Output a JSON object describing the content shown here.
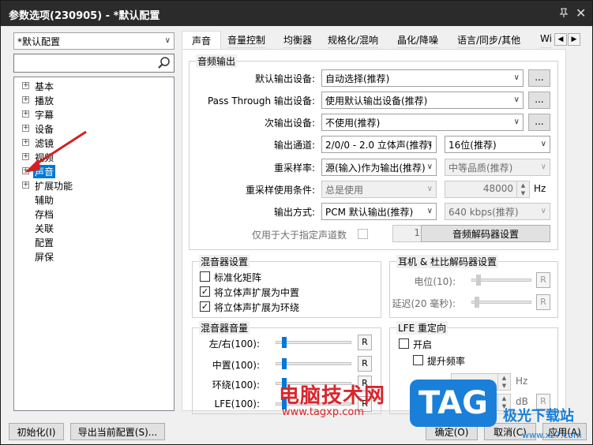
{
  "window": {
    "title": "参数选项(230905) - *默认配置",
    "pin_icon": "pin-icon",
    "close_icon": "close-icon"
  },
  "left": {
    "profile": "*默认配置",
    "search_placeholder": "",
    "tree": [
      {
        "label": "基本",
        "expandable": true
      },
      {
        "label": "播放",
        "expandable": true
      },
      {
        "label": "字幕",
        "expandable": true
      },
      {
        "label": "设备",
        "expandable": true
      },
      {
        "label": "滤镜",
        "expandable": true
      },
      {
        "label": "视频",
        "expandable": true
      },
      {
        "label": "声音",
        "expandable": true,
        "selected": true
      },
      {
        "label": "扩展功能",
        "expandable": true
      },
      {
        "label": "辅助",
        "expandable": false
      },
      {
        "label": "存档",
        "expandable": false
      },
      {
        "label": "关联",
        "expandable": false
      },
      {
        "label": "配置",
        "expandable": false
      },
      {
        "label": "屏保",
        "expandable": false
      }
    ]
  },
  "tabs": [
    "声音",
    "音量控制",
    "均衡器",
    "规格化/混响",
    "晶化/降噪",
    "语言/同步/其他",
    "Wi"
  ],
  "audio_output": {
    "title": "音频输出",
    "default_device_label": "默认输出设备:",
    "default_device_value": "自动选择(推荐)",
    "passthrough_label": "Pass Through 输出设备:",
    "passthrough_value": "使用默认输出设备(推荐)",
    "secondary_label": "次输出设备:",
    "secondary_value": "不使用(推荐)",
    "browse": "...",
    "channel_label": "输出通道:",
    "channel_value": "2/0/0 - 2.0 立体声(推荐)",
    "bits_value": "16位(推荐)",
    "resample_label": "重采样率:",
    "resample_value": "源(输入)作为输出(推荐)",
    "quality_value": "中等品质(推荐)",
    "resample_cond_label": "重采样使用条件:",
    "resample_cond_value": "总是使用",
    "rate_value": "48000",
    "rate_unit": "Hz",
    "mode_label": "输出方式:",
    "mode_value": "PCM 默认输出(推荐)",
    "kbps_value": "640 kbps(推荐)",
    "only_channels_label": "仅用于大于指定声道数",
    "only_channels_value": "1",
    "decoder_button": "音频解码器设置"
  },
  "mixer": {
    "title": "混音器设置",
    "normalize": "标准化矩阵",
    "expand_center": "将立体声扩展为中置",
    "expand_surround": "将立体声扩展为环绕"
  },
  "headphone": {
    "title": "耳机 & 杜比解码器设置",
    "level_label": "电位(10):",
    "delay_label": "延迟(20 毫秒):",
    "r": "R"
  },
  "mixer_volume": {
    "title": "混音器音量",
    "lr": "左/右(100):",
    "center": "中置(100):",
    "surround": "环绕(100):",
    "lfe": "LFE(100):",
    "r": "R",
    "levels": [
      0.1,
      0.1,
      0.1,
      0.1
    ]
  },
  "lfe": {
    "title": "LFE 重定向",
    "enable": "开启",
    "boost": "提升频率",
    "hz": "Hz",
    "db": "dB",
    "r": "R"
  },
  "footer": {
    "init": "初始化(I)",
    "export": "导出当前配置(S)...",
    "ok": "确定(O)",
    "cancel": "取消(C)",
    "apply": "应用(A)"
  },
  "watermark": {
    "cn": "电脑技术网",
    "url": "www.tagxp.com",
    "tag": "TAG",
    "site": "极光下载站",
    "site_url": "www.xz7.com"
  },
  "colors": {
    "accent": "#0078d7",
    "watermark_red": "#d9262c",
    "watermark_blue": "#1a7fd8"
  }
}
